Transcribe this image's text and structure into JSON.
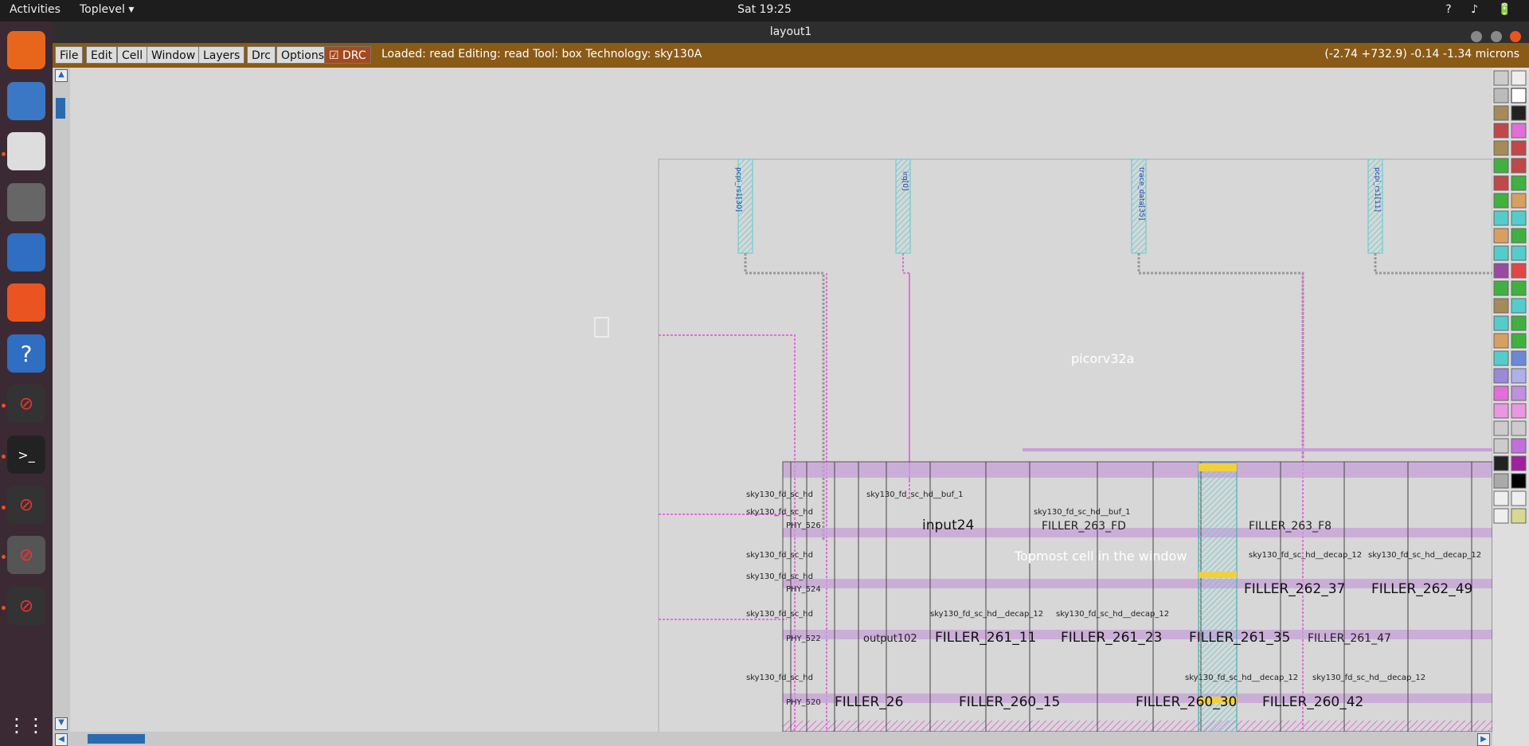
{
  "topbar": {
    "activities": "Activities",
    "app_menu": "Toplevel",
    "clock": "Sat 19:25",
    "tray": "? ♪ 🔋"
  },
  "window": {
    "title": "layout1"
  },
  "menu": {
    "file": "File",
    "edit": "Edit",
    "cell": "Cell",
    "window": "Window",
    "layers": "Layers",
    "drc_menu": "Drc",
    "options": "Options",
    "drc_toggle": "DRC"
  },
  "status": {
    "text": "Loaded: read Editing: read Tool: box  Technology: sky130A",
    "coords": "(-2.74 +732.9) -0.14 -1.34 microns"
  },
  "layout": {
    "top_cell": "picorv32a",
    "tooltip": "Topmost cell in the window",
    "pins": [
      "pcpi_rs1[30]",
      "irq[0]",
      "trace_data[35]",
      "pcpi_rs1[11]"
    ],
    "cells": {
      "input24": "input24",
      "filler_262_37": "FILLER_262_37",
      "filler_262_49": "FILLER_262_49",
      "filler_261_11": "FILLER_261_11",
      "filler_261_23": "FILLER_261_23",
      "filler_261_35": "FILLER_261_35",
      "filler_261_47": "FILLER_261_47",
      "filler_260_15": "FILLER_260_15",
      "filler_260_30": "FILLER_260_30",
      "filler_260_42": "FILLER_260_42",
      "filler_26": "FILLER_26",
      "filler_263_fd": "FILLER_263_FD",
      "filler_263_f8": "FILLER_263_F8",
      "phy_520": "PHY_520",
      "phy_522": "PHY_522",
      "phy_524": "PHY_524",
      "phy_526": "PHY_526",
      "output102": "output102",
      "decap_12": "sky130_fd_sc_hd__decap_12",
      "decap_12b": "sky130_fd_sc_hd__decap_12",
      "decap_12c": "sky130_fd_sc_hd__decap_12",
      "decap_12d": "sky130_fd_sc_hd__decap_12",
      "decap_12e": "sky130_fd_sc_hd__decap_12",
      "decap_12f": "sky130_fd_sc_hd__decap_12",
      "sky_generic": "sky130_fd_sc_hd",
      "sky_buf": "sky130_fd_sc_hd__buf_1"
    }
  },
  "colors": {
    "menubar": "#8a5a17",
    "canvas": "#d7d7d7",
    "metal_pink": "#e070d8",
    "row_purple": "#c7a0d8",
    "pin_cyan": "#70d8d8",
    "drc_red": "#a54a1c"
  }
}
